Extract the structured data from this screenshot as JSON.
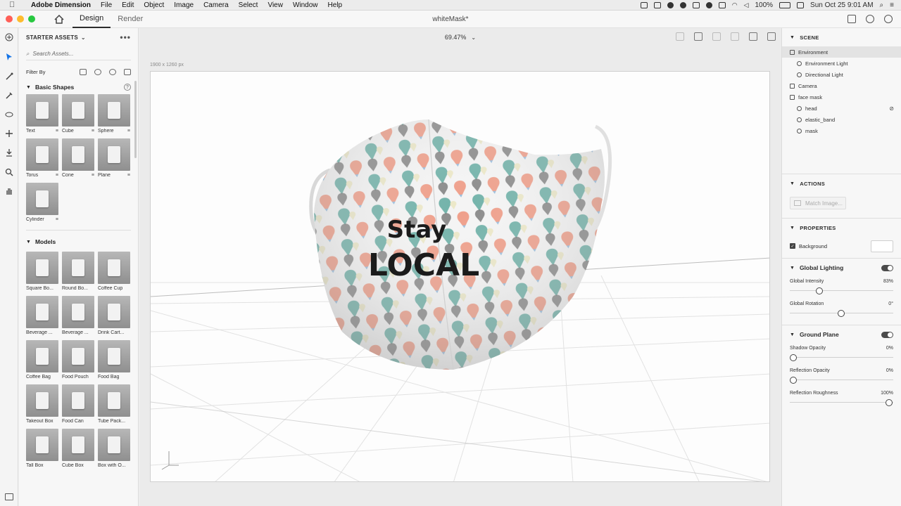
{
  "menubar": {
    "app_name": "Adobe Dimension",
    "items": [
      "File",
      "Edit",
      "Object",
      "Image",
      "Camera",
      "Select",
      "View",
      "Window",
      "Help"
    ],
    "battery": "100%",
    "clock": "Sun Oct 25  9:01 AM"
  },
  "titlebar": {
    "tabs": [
      "Design",
      "Render"
    ],
    "active_tab": "Design",
    "document_title": "whiteMask*"
  },
  "assets_panel": {
    "title": "STARTER ASSETS",
    "search_placeholder": "Search Assets...",
    "filter_label": "Filter By",
    "basic_shapes": {
      "title": "Basic Shapes",
      "items": [
        "Text",
        "Cube",
        "Sphere",
        "Torus",
        "Cone",
        "Plane",
        "Cylinder"
      ]
    },
    "models": {
      "title": "Models",
      "items": [
        "Square Bo...",
        "Round Bo...",
        "Coffee Cup",
        "Beverage ...",
        "Beverage ...",
        "Drink Cart...",
        "Coffee Bag",
        "Food Pouch",
        "Food Bag",
        "Takeout Box",
        "Food Can",
        "Tube Pack...",
        "Tall Box",
        "Cube Box",
        "Box with O..."
      ]
    }
  },
  "canvas": {
    "zoom": "69.47%",
    "canvas_size": "1900 x 1260 px",
    "mask_text_line1": "Stay",
    "mask_text_line2": "LOCAL"
  },
  "scene_panel": {
    "title": "SCENE",
    "items": [
      {
        "label": "Environment",
        "indent": 0
      },
      {
        "label": "Environment Light",
        "indent": 1
      },
      {
        "label": "Directional Light",
        "indent": 1
      },
      {
        "label": "Camera",
        "indent": 0
      },
      {
        "label": "face mask",
        "indent": 0
      },
      {
        "label": "head",
        "indent": 1
      },
      {
        "label": "elastic_band",
        "indent": 1
      },
      {
        "label": "mask",
        "indent": 1
      }
    ]
  },
  "actions_panel": {
    "title": "ACTIONS",
    "match_image": "Match Image..."
  },
  "properties_panel": {
    "title": "PROPERTIES",
    "background_label": "Background",
    "global_lighting": {
      "title": "Global Lighting",
      "intensity_label": "Global Intensity",
      "intensity_value": "83%",
      "intensity_fraction": 0.27,
      "rotation_label": "Global Rotation",
      "rotation_value": "0°",
      "rotation_fraction": 0.5
    },
    "ground_plane": {
      "title": "Ground Plane",
      "shadow_label": "Shadow Opacity",
      "shadow_value": "0%",
      "shadow_fraction": 0,
      "reflection_label": "Reflection Opacity",
      "reflection_value": "0%",
      "reflection_fraction": 0,
      "roughness_label": "Reflection Roughness",
      "roughness_value": "100%",
      "roughness_fraction": 1
    }
  },
  "colors": {
    "close": "#ff5f57",
    "minimize": "#febc2e",
    "zoom": "#28c840",
    "pin_teal": "#5aa79c",
    "pin_blue": "#8ab4da",
    "pin_salmon": "#ef8f77",
    "pin_gray": "#6f6f6f",
    "pin_cream": "#ece7c4"
  }
}
